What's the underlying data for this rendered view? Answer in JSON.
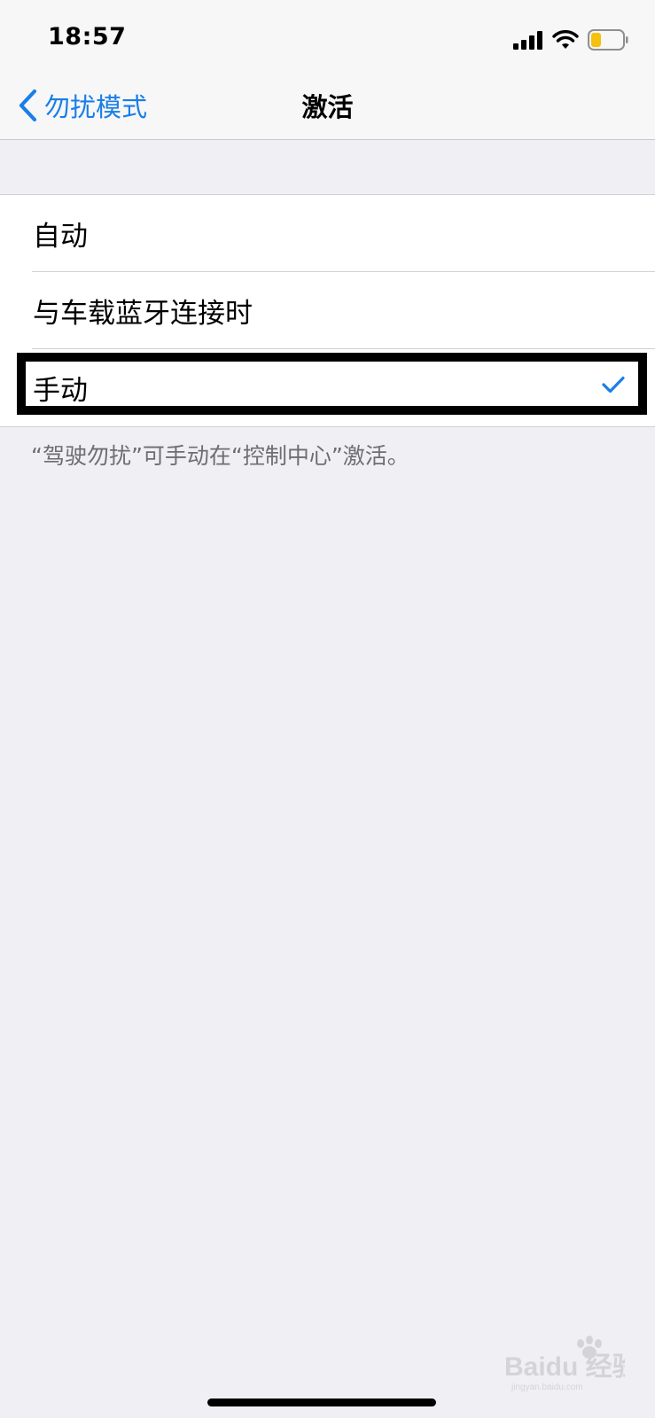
{
  "status_bar": {
    "time": "18:57",
    "icons": [
      "cellular-signal-icon",
      "wifi-icon",
      "battery-low-icon"
    ],
    "battery_color": "#f4c20d"
  },
  "nav": {
    "back_label": "勿扰模式",
    "title": "激活",
    "accent_color": "#1a7ee8"
  },
  "options": [
    {
      "label": "自动",
      "selected": false
    },
    {
      "label": "与车载蓝牙连接时",
      "selected": false
    },
    {
      "label": "手动",
      "selected": true
    }
  ],
  "footer_note": "“驾驶勿扰”可手动在“控制中心”激活。",
  "watermark": {
    "label": "Baidu 经验",
    "sub": "jingyan.baidu.com"
  }
}
